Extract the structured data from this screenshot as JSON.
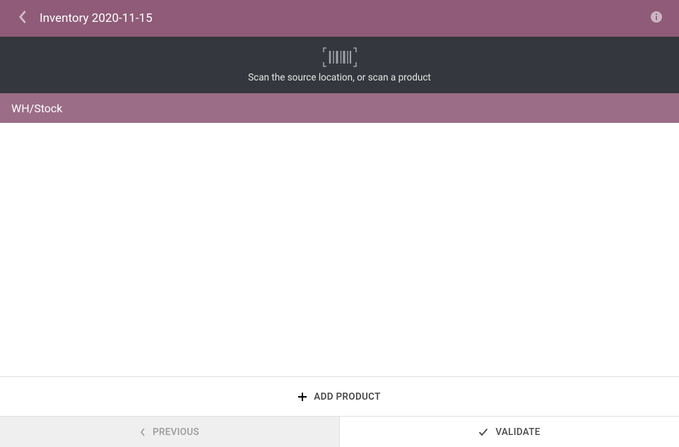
{
  "header": {
    "title": "Inventory 2020-11-15"
  },
  "scanBanner": {
    "message": "Scan the source location, or scan a product"
  },
  "location": {
    "name": "WH/Stock"
  },
  "addProduct": {
    "label": "ADD PRODUCT"
  },
  "bottomActions": {
    "previous": "PREVIOUS",
    "validate": "VALIDATE"
  }
}
